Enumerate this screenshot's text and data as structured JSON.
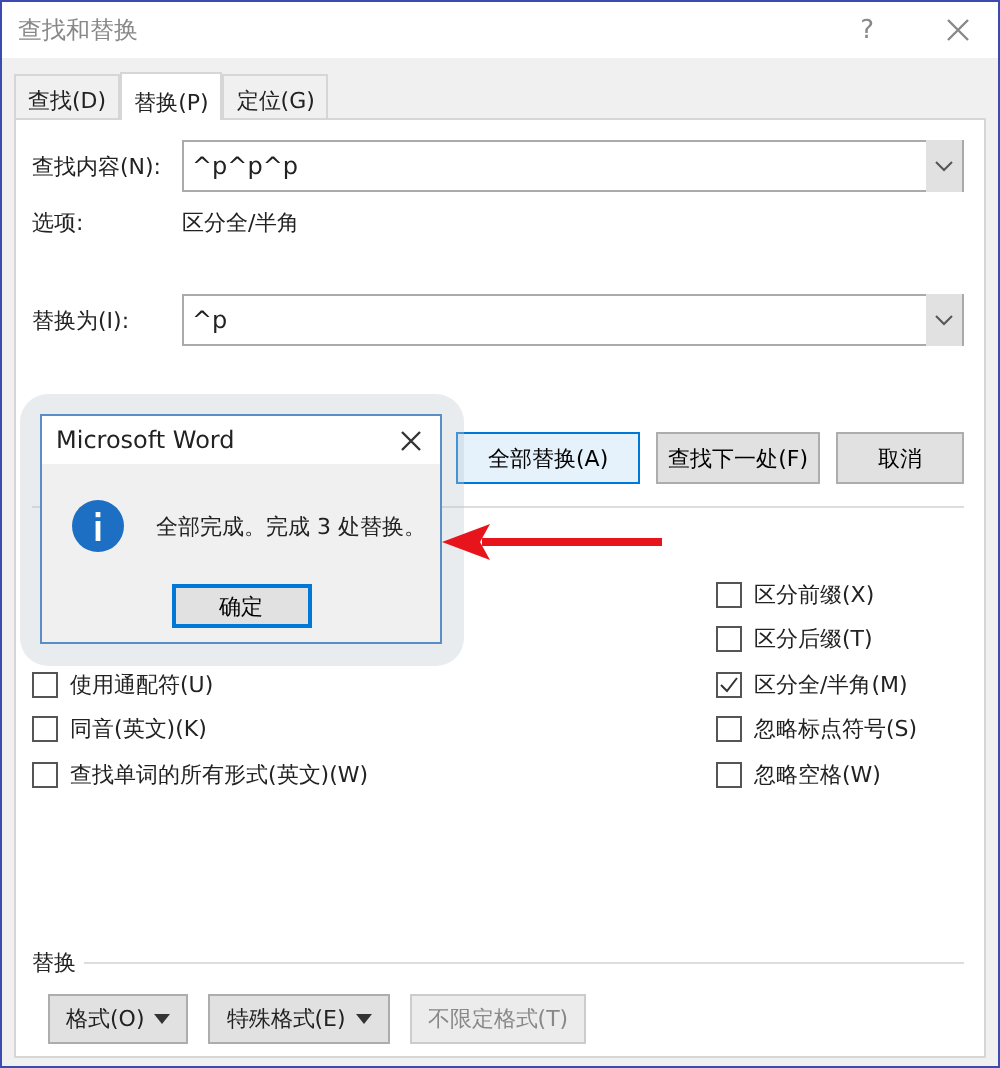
{
  "window": {
    "title": "查找和替换",
    "help": "?"
  },
  "tabs": [
    {
      "label": "查找(D)",
      "selected": false
    },
    {
      "label": "替换(P)",
      "selected": true
    },
    {
      "label": "定位(G)",
      "selected": false
    }
  ],
  "find": {
    "label": "查找内容(N):",
    "value": "^p^p^p",
    "options_label": "选项:",
    "options_value": "区分全/半角"
  },
  "replace": {
    "label": "替换为(I):",
    "value": "^p"
  },
  "buttons": [
    {
      "label": "全部替换(A)",
      "default": true
    },
    {
      "label": "查找下一处(F)",
      "default": false
    },
    {
      "label": "取消",
      "default": false
    }
  ],
  "options_left": [
    {
      "label": "使用通配符(U)",
      "checked": false
    },
    {
      "label": "同音(英文)(K)",
      "checked": false
    },
    {
      "label": "查找单词的所有形式(英文)(W)",
      "checked": false
    }
  ],
  "options_right": [
    {
      "label": "区分前缀(X)",
      "checked": false
    },
    {
      "label": "区分后缀(T)",
      "checked": false
    },
    {
      "label": "区分全/半角(M)",
      "checked": true
    },
    {
      "label": "忽略标点符号(S)",
      "checked": false
    },
    {
      "label": "忽略空格(W)",
      "checked": false
    }
  ],
  "format_section": {
    "title": "替换",
    "buttons": [
      {
        "label": "格式(O)",
        "dropdown": true,
        "disabled": false
      },
      {
        "label": "特殊格式(E)",
        "dropdown": true,
        "disabled": false
      },
      {
        "label": "不限定格式(T)",
        "dropdown": false,
        "disabled": true
      }
    ]
  },
  "message_box": {
    "title": "Microsoft Word",
    "message": "全部完成。完成 3 处替换。",
    "ok": "确定"
  }
}
